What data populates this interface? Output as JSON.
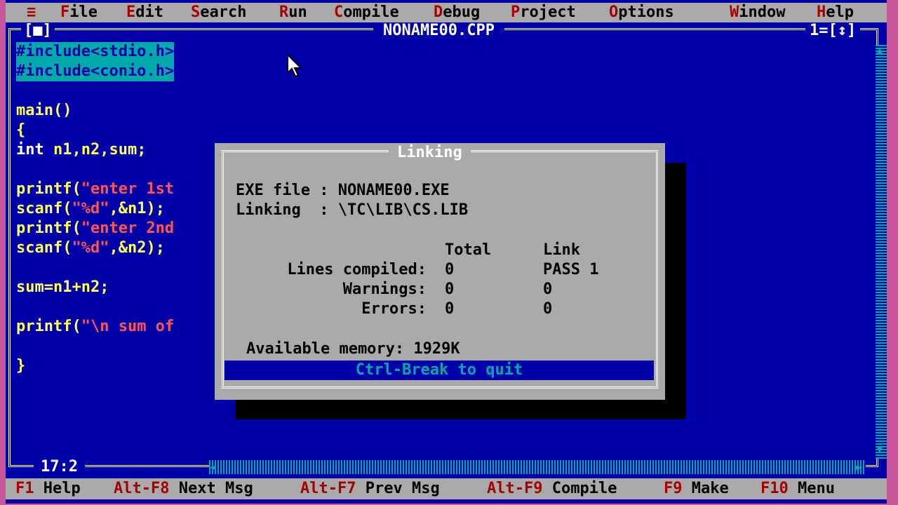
{
  "menubar": {
    "system": "≡",
    "items": [
      {
        "hot": "F",
        "rest": "ile"
      },
      {
        "hot": "E",
        "rest": "dit"
      },
      {
        "hot": "S",
        "rest": "earch"
      },
      {
        "hot": "R",
        "rest": "un"
      },
      {
        "hot": "C",
        "rest": "ompile"
      },
      {
        "hot": "D",
        "rest": "ebug"
      },
      {
        "hot": "P",
        "rest": "roject"
      },
      {
        "hot": "O",
        "rest": "ptions"
      },
      {
        "hot": "W",
        "rest": "indow"
      },
      {
        "hot": "H",
        "rest": "elp"
      }
    ]
  },
  "window": {
    "title": "NONAME00.CPP",
    "close": "[■]",
    "number": "1=[↕]",
    "cursor_pos": "17:2"
  },
  "code": {
    "l1": "#include<stdio.h>",
    "l2": "#include<conio.h>",
    "l3": "main()",
    "l4": "{",
    "l5a": "int",
    "l5b": " n1,n2,sum;",
    "l6a": "printf(",
    "l6b": "\"enter 1st",
    "l7a": "scanf(",
    "l7b": "\"%d\"",
    "l7c": ",&n1);",
    "l8a": "printf(",
    "l8b": "\"enter 2nd",
    "l9a": "scanf(",
    "l9b": "\"%d\"",
    "l9c": ",&n2);",
    "l10": "sum=n1+n2;",
    "l11a": "printf(",
    "l11b": "\"\\n sum of",
    "l12": "}"
  },
  "dialog": {
    "title": "Linking",
    "exe_label": "EXE file : NONAME00.EXE",
    "linking_label": "Linking  : \\TC\\LIB\\CS.LIB",
    "col_total": "Total",
    "col_link": "Link",
    "rows": [
      {
        "label": "Lines compiled:",
        "total": "0",
        "link": "PASS 1"
      },
      {
        "label": "Warnings:",
        "total": "0",
        "link": "0"
      },
      {
        "label": "Errors:",
        "total": "0",
        "link": "0"
      }
    ],
    "memory": "Available memory: 1929K",
    "quit": "Ctrl-Break to quit"
  },
  "statusbar": {
    "items": [
      {
        "key": "F1",
        "label": " Help"
      },
      {
        "key": "Alt-F8",
        "label": " Next Msg"
      },
      {
        "key": "Alt-F7",
        "label": " Prev Msg"
      },
      {
        "key": "Alt-F9",
        "label": " Compile"
      },
      {
        "key": "F9",
        "label": " Make"
      },
      {
        "key": "F10",
        "label": " Menu"
      }
    ]
  },
  "colors": {
    "desktop": "#0000a8",
    "menu": "#aaaaaa",
    "hotkey": "#a80000",
    "code": "#ffff55",
    "string": "#ff5555"
  }
}
